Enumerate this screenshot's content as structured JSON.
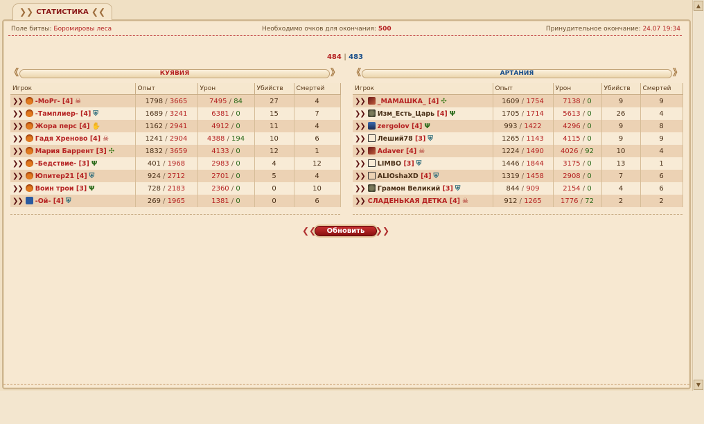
{
  "tab": {
    "title": "СТАТИСТИКА"
  },
  "info": {
    "battlefield_label": "Поле битвы:",
    "battlefield_value": "Боромировы леса",
    "points_label": "Необходимо очков для окончания:",
    "points_value": "500",
    "end_label": "Принудительное окончание:",
    "end_value": "24.07 19:34"
  },
  "score": {
    "left": "484",
    "separator": "|",
    "right": "483"
  },
  "columns": [
    "Игрок",
    "Опыт",
    "Урон",
    "Убийств",
    "Смертей"
  ],
  "colors": {
    "left_team": "#b52222",
    "right_team": "#1a4f8a",
    "accent_green": "#2a6a1a"
  },
  "teams": [
    {
      "name": "КУЯВИЯ",
      "players": [
        {
          "name": "-МоРг-",
          "level": "[4]",
          "avatar": "flame-avatar",
          "emblem": "skull-emblem",
          "exp": "1798",
          "exp_max": "3665",
          "dmg": "7495",
          "dmg_extra": "84",
          "kills": "27",
          "deaths": "4"
        },
        {
          "name": "-Тамплиер-",
          "level": "[4]",
          "avatar": "flame-avatar",
          "emblem": "shield-emblem",
          "exp": "1689",
          "exp_max": "3241",
          "dmg": "6381",
          "dmg_extra": "0",
          "kills": "15",
          "deaths": "7"
        },
        {
          "name": "Жора перс",
          "level": "[4]",
          "avatar": "flame-avatar",
          "emblem": "hand-emblem",
          "exp": "1162",
          "exp_max": "2941",
          "dmg": "4912",
          "dmg_extra": "0",
          "kills": "11",
          "deaths": "4"
        },
        {
          "name": "Гадя Хреново",
          "level": "[4]",
          "avatar": "flame-avatar",
          "emblem": "skull-emblem",
          "exp": "1241",
          "exp_max": "2904",
          "dmg": "4388",
          "dmg_extra": "194",
          "kills": "10",
          "deaths": "6"
        },
        {
          "name": "Мария Баррент",
          "level": "[3]",
          "avatar": "flame-avatar",
          "emblem": "cross-emblem",
          "exp": "1832",
          "exp_max": "3659",
          "dmg": "4133",
          "dmg_extra": "0",
          "kills": "12",
          "deaths": "1"
        },
        {
          "name": "-Бедствие-",
          "level": "[3]",
          "avatar": "flame-avatar",
          "emblem": "trident-emblem",
          "exp": "401",
          "exp_max": "1968",
          "dmg": "2983",
          "dmg_extra": "0",
          "kills": "4",
          "deaths": "12"
        },
        {
          "name": "Юпитер21",
          "level": "[4]",
          "avatar": "flame-avatar",
          "emblem": "shield-emblem",
          "exp": "924",
          "exp_max": "2712",
          "dmg": "2701",
          "dmg_extra": "0",
          "kills": "5",
          "deaths": "4"
        },
        {
          "name": "Воин трои",
          "level": "[3]",
          "avatar": "flame-avatar",
          "emblem": "trident-emblem",
          "exp": "728",
          "exp_max": "2183",
          "dmg": "2360",
          "dmg_extra": "0",
          "kills": "0",
          "deaths": "10"
        },
        {
          "name": "-Ой-",
          "level": "[4]",
          "avatar": "star-avatar",
          "emblem": "shield-emblem",
          "exp": "269",
          "exp_max": "1965",
          "dmg": "1381",
          "dmg_extra": "0",
          "kills": "0",
          "deaths": "6"
        }
      ]
    },
    {
      "name": "АРТАНИЯ",
      "players": [
        {
          "name": "_МАМАШКА_",
          "level": "[4]",
          "avatar": "mage-avatar",
          "emblem": "cross-emblem",
          "exp": "1609",
          "exp_max": "1754",
          "dmg": "7138",
          "dmg_extra": "0",
          "kills": "9",
          "deaths": "9"
        },
        {
          "name": "Изм_Есть_Царь",
          "level": "[4]",
          "avatar": "beast-avatar",
          "emblem": "trident-emblem",
          "exp": "1705",
          "exp_max": "1714",
          "dmg": "5613",
          "dmg_extra": "0",
          "kills": "26",
          "deaths": "4"
        },
        {
          "name": "zergolov",
          "level": "[4]",
          "avatar": "warrior-avatar",
          "emblem": "trident-emblem",
          "exp": "993",
          "exp_max": "1422",
          "dmg": "4296",
          "dmg_extra": "0",
          "kills": "9",
          "deaths": "8"
        },
        {
          "name": "Леший78",
          "level": "[3]",
          "avatar": "rune-avatar",
          "emblem": "shield-emblem",
          "exp": "1265",
          "exp_max": "1143",
          "dmg": "4115",
          "dmg_extra": "0",
          "kills": "9",
          "deaths": "9"
        },
        {
          "name": "Adaver",
          "level": "[4]",
          "avatar": "mage-avatar",
          "emblem": "skull-emblem",
          "exp": "1224",
          "exp_max": "1490",
          "dmg": "4026",
          "dmg_extra": "92",
          "kills": "10",
          "deaths": "4"
        },
        {
          "name": "LIMBO",
          "level": "[3]",
          "avatar": "rune-avatar",
          "emblem": "shield-emblem",
          "exp": "1446",
          "exp_max": "1844",
          "dmg": "3175",
          "dmg_extra": "0",
          "kills": "13",
          "deaths": "1"
        },
        {
          "name": "ALIOshaXD",
          "level": "[4]",
          "avatar": "rune-avatar",
          "emblem": "shield-emblem",
          "exp": "1319",
          "exp_max": "1458",
          "dmg": "2908",
          "dmg_extra": "0",
          "kills": "7",
          "deaths": "6"
        },
        {
          "name": "Грамон Великий",
          "level": "[3]",
          "avatar": "beast-avatar",
          "emblem": "shield-emblem",
          "exp": "844",
          "exp_max": "909",
          "dmg": "2154",
          "dmg_extra": "0",
          "kills": "4",
          "deaths": "6"
        },
        {
          "name": "СЛАДЕНЬКАЯ ДЕТКА",
          "level": "[4]",
          "avatar": "none",
          "emblem": "skull-emblem",
          "exp": "912",
          "exp_max": "1265",
          "dmg": "1776",
          "dmg_extra": "72",
          "kills": "2",
          "deaths": "2"
        }
      ]
    }
  ],
  "refresh_label": "Обновить"
}
